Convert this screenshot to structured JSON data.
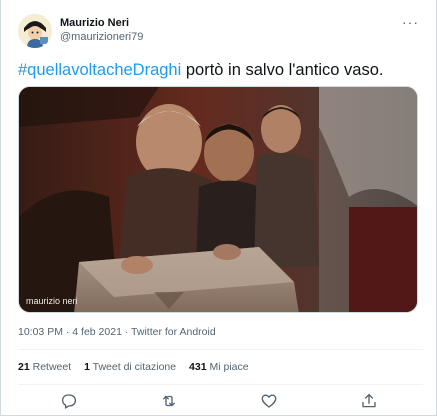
{
  "tweet": {
    "author": {
      "display_name": "Maurizio Neri",
      "handle": "@maurizioneri79"
    },
    "more_label": "···",
    "hashtag": "#quellavoltacheDraghi",
    "text_after_hashtag": " portò in salvo l'antico vaso.",
    "media": {
      "watermark": "maurizio neri"
    },
    "meta": "10:03 PM · 4 feb 2021 · Twitter for Android",
    "stats": {
      "retweets_count": "21",
      "retweets_label": "Retweet",
      "quotes_count": "1",
      "quotes_label": "Tweet di citazione",
      "likes_count": "431",
      "likes_label": "Mi piace"
    },
    "actions": [
      "reply-icon",
      "retweet-icon",
      "like-icon",
      "share-icon"
    ],
    "colors": {
      "link": "#1d9bf0",
      "secondary_text": "#536471",
      "border": "#cfd9de"
    }
  }
}
